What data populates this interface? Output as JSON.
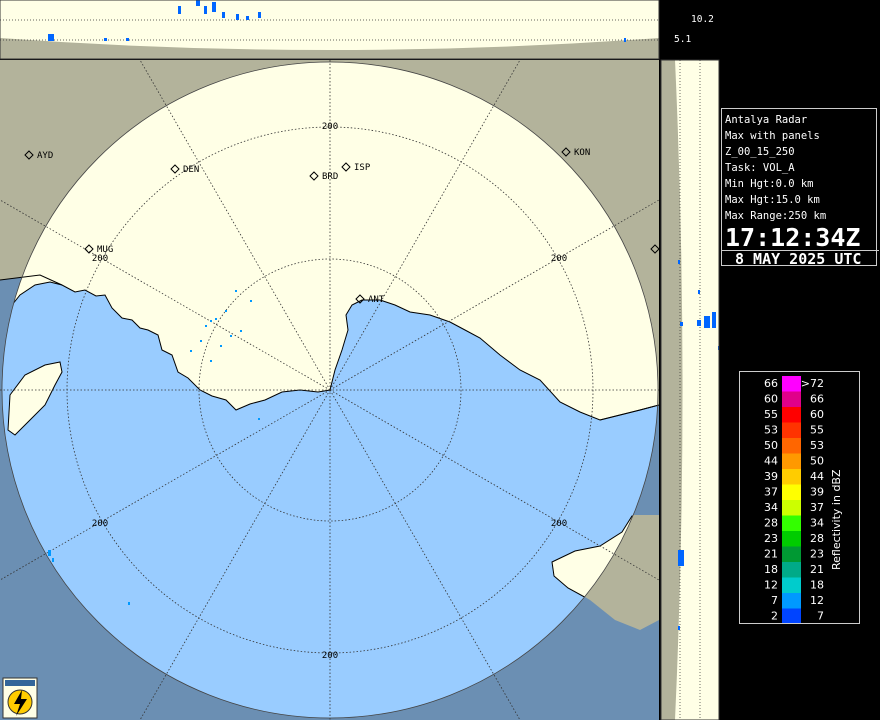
{
  "panel_labels": {
    "top_max_height": "10.2",
    "top_mid_height": "5.1"
  },
  "info": {
    "radar_name": "Antalya Radar",
    "product": "Max with panels",
    "product_code": "Z_00_15_250",
    "task": "Task: VOL_A",
    "min_height": "Min Hgt:0.0 km",
    "max_height": "Max Hgt:15.0 km",
    "max_range": "Max Range:250 km",
    "time": "17:12:34Z",
    "date": "8 MAY 2025 UTC"
  },
  "legend": {
    "title": "Reflectivity in dBZ",
    "rows": [
      {
        "lo": "66",
        "hi": ">72",
        "color": "#ff00ff"
      },
      {
        "lo": "60",
        "hi": "66",
        "color": "#e0008a"
      },
      {
        "lo": "55",
        "hi": "60",
        "color": "#ff0000"
      },
      {
        "lo": "53",
        "hi": "55",
        "color": "#ff3300"
      },
      {
        "lo": "50",
        "hi": "53",
        "color": "#ff6600"
      },
      {
        "lo": "44",
        "hi": "50",
        "color": "#ff9900"
      },
      {
        "lo": "39",
        "hi": "44",
        "color": "#ffcc00"
      },
      {
        "lo": "37",
        "hi": "39",
        "color": "#ffff00"
      },
      {
        "lo": "34",
        "hi": "37",
        "color": "#ccff00"
      },
      {
        "lo": "28",
        "hi": "34",
        "color": "#33ff00"
      },
      {
        "lo": "23",
        "hi": "28",
        "color": "#00cc00"
      },
      {
        "lo": "21",
        "hi": "23",
        "color": "#009933"
      },
      {
        "lo": "18",
        "hi": "21",
        "color": "#00aa88"
      },
      {
        "lo": "12",
        "hi": "18",
        "color": "#00cccc"
      },
      {
        "lo": "7",
        "hi": "12",
        "color": "#0099ff"
      },
      {
        "lo": "2",
        "hi": "7",
        "color": "#0044ff"
      }
    ]
  },
  "range_labels": [
    "200",
    "200",
    "200",
    "200",
    "200",
    "200"
  ],
  "cities": [
    {
      "code": "AYD"
    },
    {
      "code": "DEN"
    },
    {
      "code": "BRD"
    },
    {
      "code": "ISP"
    },
    {
      "code": "KON"
    },
    {
      "code": "MUG"
    },
    {
      "code": "ANT"
    }
  ],
  "colors": {
    "sea_inside": "#99ccff",
    "land_inside": "#ffffe6",
    "land_outside": "#b3b39b",
    "sea_outside": "#6b8fb3",
    "echo": "#0099ff"
  }
}
